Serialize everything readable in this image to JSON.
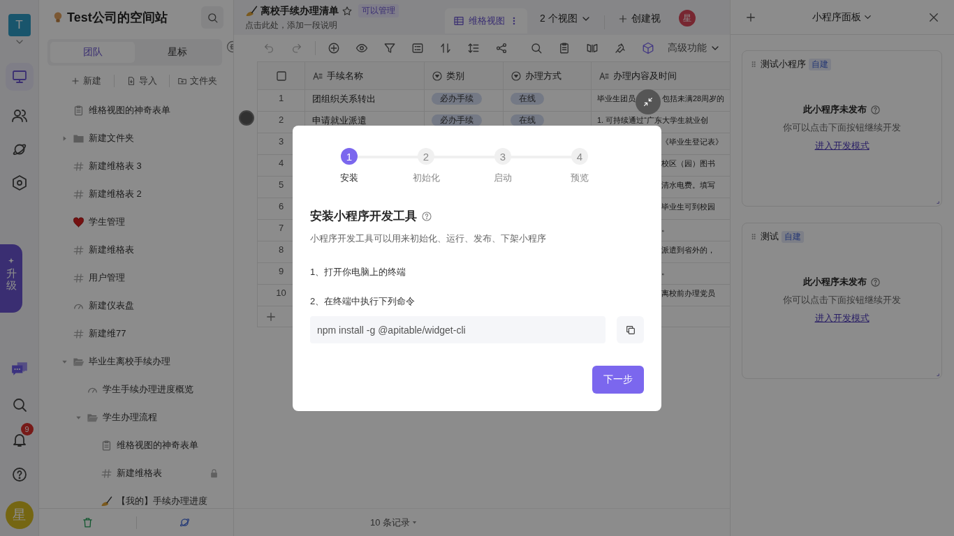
{
  "rail": {
    "workspace_avatar": "T",
    "upgrade": "升级",
    "notifications": "9",
    "user_avatar": "星"
  },
  "sidebar": {
    "title": "Test公司的空间站",
    "tabs": [
      {
        "label": "团队",
        "selected": true
      },
      {
        "label": "星标",
        "selected": false
      }
    ],
    "actions": [
      {
        "label": "新建",
        "kind": "new"
      },
      {
        "label": "导入",
        "kind": "import"
      },
      {
        "label": "文件夹",
        "kind": "folder"
      }
    ],
    "tree": [
      {
        "label": "维格视图的神奇表单",
        "kind": "form"
      },
      {
        "label": "新建文件夹",
        "kind": "folder",
        "expanded": false
      },
      {
        "label": "新建维格表 3",
        "kind": "sheet"
      },
      {
        "label": "新建维格表 2",
        "kind": "sheet"
      },
      {
        "label": "学生管理",
        "kind": "heart"
      },
      {
        "label": "新建维格表",
        "kind": "sheet"
      },
      {
        "label": "用户管理",
        "kind": "sheet"
      },
      {
        "label": "新建仪表盘",
        "kind": "dashboard"
      },
      {
        "label": "新建维77",
        "kind": "sheet"
      },
      {
        "label": "毕业生离校手续办理",
        "kind": "folder",
        "expanded": true,
        "children": [
          {
            "label": "学生手续办理进度概览",
            "kind": "dashboard"
          },
          {
            "label": "学生办理流程",
            "kind": "folder",
            "expanded": true,
            "children": [
              {
                "label": "维格视图的神奇表单",
                "kind": "form",
                "locked": false
              },
              {
                "label": "新建维格表",
                "kind": "sheet",
                "locked": true
              },
              {
                "label": "【我的】手续办理进度",
                "kind": "pen",
                "locked": false
              }
            ]
          }
        ]
      }
    ]
  },
  "sheet": {
    "title": "离校手续办理清单",
    "permission": "可以管理",
    "description": "点击此处，添加一段说明",
    "views": [
      {
        "label": "维格视图",
        "selected": true
      }
    ],
    "view_count": "2 个视图",
    "create_view": "创建视",
    "collaborator": "星"
  },
  "toolbar": {
    "advanced": "高级功能"
  },
  "table": {
    "columns": [
      {
        "title": "手续名称",
        "kind": "text"
      },
      {
        "title": "类别",
        "kind": "select"
      },
      {
        "title": "办理方式",
        "kind": "select"
      },
      {
        "title": "办理内容及时间",
        "kind": "text"
      }
    ],
    "select_all": {
      "checked": false
    },
    "rows": [
      {
        "kind": "full",
        "number": "1",
        "name": "团组织关系转出",
        "category": "必办手续",
        "method": "在线",
        "content": "毕业生团员",
        "content_after": "包括未满28周岁的"
      },
      {
        "kind": "full",
        "number": "2",
        "name": "申请就业派遣",
        "category": "必办手续",
        "method": "在线",
        "content": "1. 可持续通过“广东大学生就业创"
      },
      {
        "kind": "partial",
        "number": "3",
        "content": "《毕业生登记表》"
      },
      {
        "kind": "partial",
        "number": "4",
        "content": "校区（园）图书"
      },
      {
        "kind": "partial",
        "number": "5",
        "content": "清水电费。填写"
      },
      {
        "kind": "partial",
        "number": "6",
        "content": "毕业生可到校园"
      },
      {
        "kind": "partial",
        "number": "7",
        "content": "。"
      },
      {
        "kind": "partial",
        "number": "8",
        "content": "派遣到省外的，"
      },
      {
        "kind": "partial",
        "number": "9",
        "content": "。"
      },
      {
        "kind": "partial",
        "number": "10",
        "content": "离校前办理党员"
      }
    ],
    "footer": "10 条记录"
  },
  "panel": {
    "title": "小程序面板",
    "widgets": [
      {
        "name": "测试小程序",
        "tag": "自建",
        "status": "此小程序未发布",
        "hint": "你可以点击下面按钮继续开发",
        "link": "进入开发模式"
      },
      {
        "name": "测试",
        "tag": "自建",
        "status": "此小程序未发布",
        "hint": "你可以点击下面按钮继续开发",
        "link": "进入开发模式"
      }
    ]
  },
  "modal": {
    "steps": [
      {
        "number": "1",
        "label": "安装",
        "selected": true
      },
      {
        "number": "2",
        "label": "初始化",
        "selected": false
      },
      {
        "number": "3",
        "label": "启动",
        "selected": false
      },
      {
        "number": "4",
        "label": "预览",
        "selected": false
      }
    ],
    "title": "安装小程序开发工具",
    "description": "小程序开发工具可以用来初始化、运行、发布、下架小程序",
    "instructions": [
      "1、打开你电脑上的终端",
      "2、在终端中执行下列命令"
    ],
    "command": "npm install -g @apitable/widget-cli",
    "next_button": "下一步"
  }
}
